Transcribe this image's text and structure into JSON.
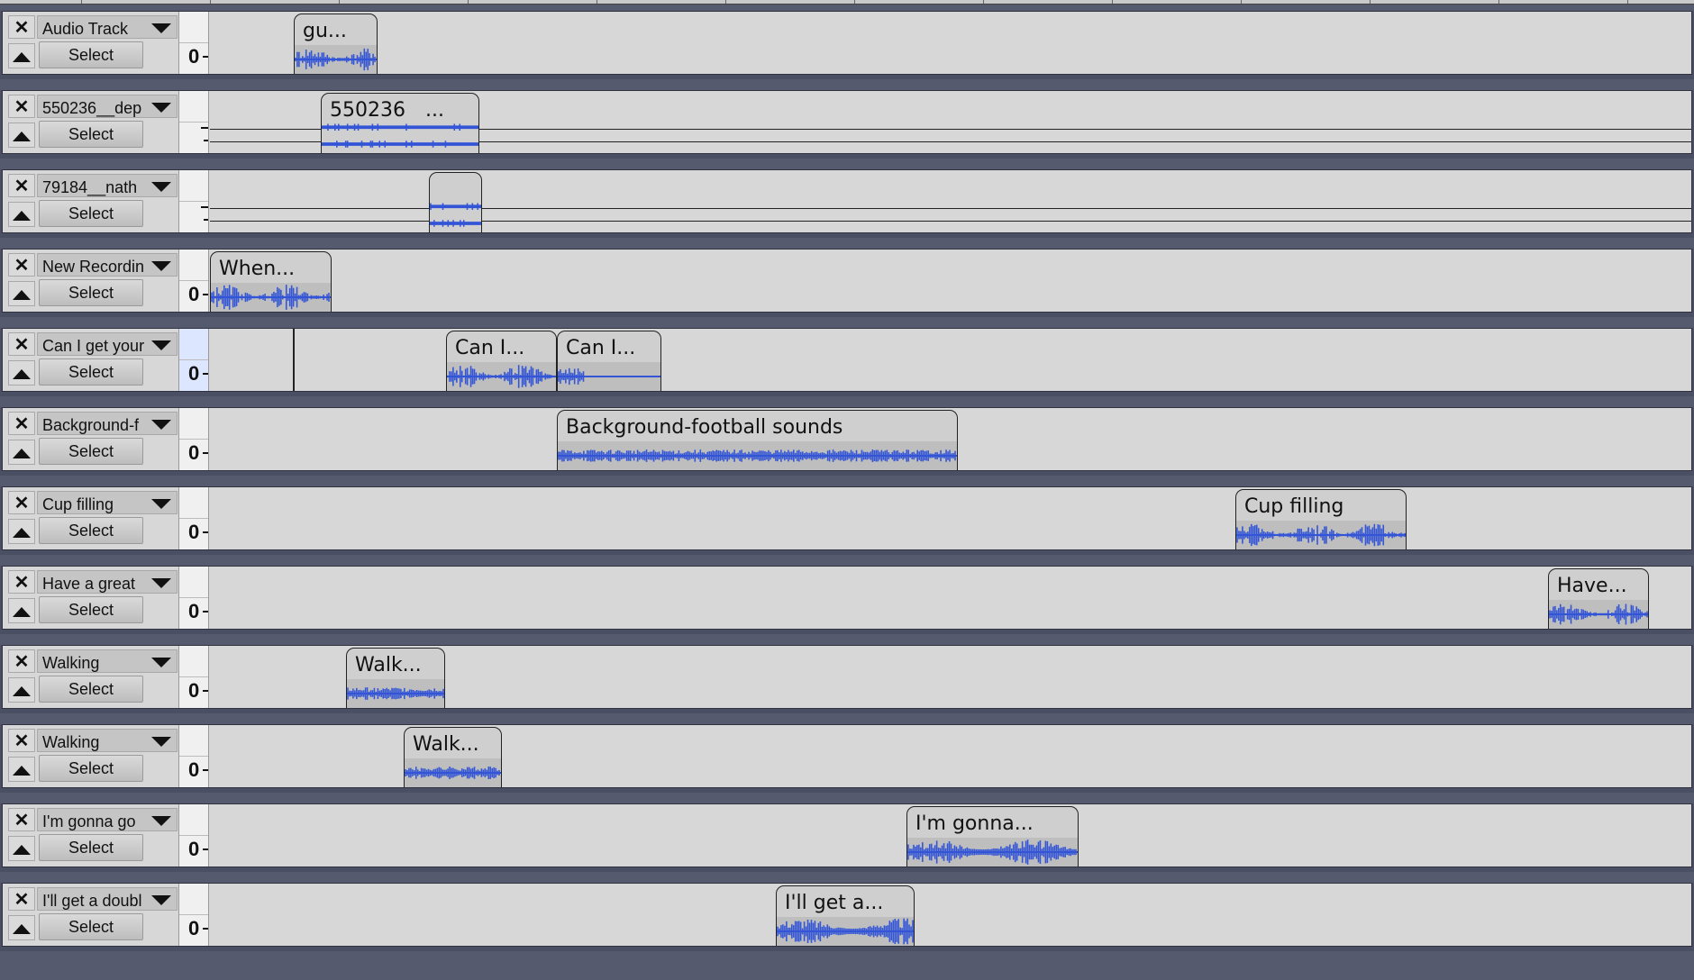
{
  "ui": {
    "close_glyph": "✕",
    "select_label": "Select",
    "level_zero": "0"
  },
  "colors": {
    "waveform": "#3355d6",
    "track_bg": "#d7d7d7",
    "separator": "#4a4f63"
  },
  "tracks": [
    {
      "name": "Audio Track",
      "meter": "0",
      "clips": [
        {
          "title": "gu..."
        }
      ]
    },
    {
      "name": "550236__dep",
      "meter": "",
      "clips": [
        {
          "title": "550236__..."
        }
      ]
    },
    {
      "name": "79184__nath",
      "meter": "",
      "clips": [
        {
          "title": ""
        }
      ]
    },
    {
      "name": "New Recordin",
      "meter": "0",
      "clips": [
        {
          "title": "When..."
        }
      ]
    },
    {
      "name": "Can I get your",
      "meter": "0",
      "clips": [
        {
          "title": "Can I..."
        },
        {
          "title": "Can I..."
        }
      ]
    },
    {
      "name": "Background-f",
      "meter": "0",
      "clips": [
        {
          "title": "Background-football sounds"
        }
      ]
    },
    {
      "name": "Cup filling",
      "meter": "0",
      "clips": [
        {
          "title": "Cup filling"
        }
      ]
    },
    {
      "name": "Have a great",
      "meter": "0",
      "clips": [
        {
          "title": "Have..."
        }
      ]
    },
    {
      "name": "Walking",
      "meter": "0",
      "clips": [
        {
          "title": "Walk..."
        }
      ]
    },
    {
      "name": "Walking",
      "meter": "0",
      "clips": [
        {
          "title": "Walk..."
        }
      ]
    },
    {
      "name": "I'm gonna go",
      "meter": "0",
      "clips": [
        {
          "title": "I'm gonna..."
        }
      ]
    },
    {
      "name": "I'll get a doubl",
      "meter": "0",
      "clips": [
        {
          "title": "I'll get a..."
        }
      ]
    }
  ]
}
